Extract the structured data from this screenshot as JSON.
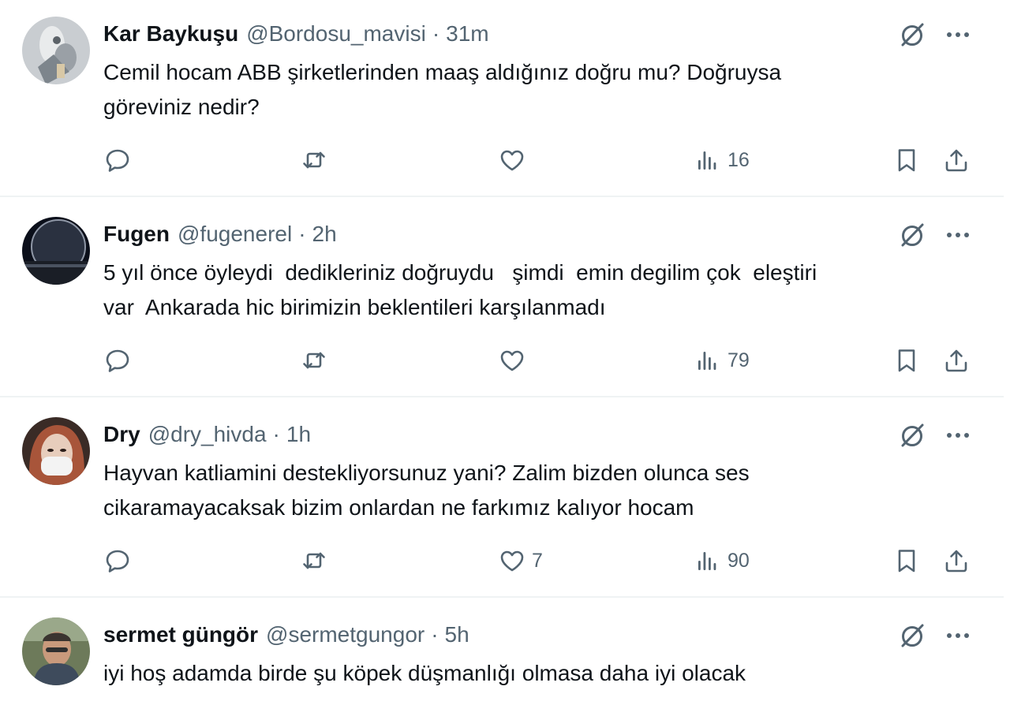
{
  "tweets": [
    {
      "name": "Kar Baykuşu",
      "handle": "@Bordosu_mavisi",
      "separator": "·",
      "time": "31m",
      "text": "Cemil hocam ABB şirketlerinden maaş aldığınız doğru mu? Doğruysa\ngöreviniz nedir?",
      "replies": "",
      "retweets": "",
      "likes": "",
      "views": "16"
    },
    {
      "name": "Fugen",
      "handle": "@fugenerel",
      "separator": "·",
      "time": "2h",
      "text": "5 yıl önce öyleydi  dedikleriniz doğruydu   şimdi  emin degilim çok  eleştiri\nvar  Ankarada hic birimizin beklentileri karşılanmadı",
      "replies": "",
      "retweets": "",
      "likes": "",
      "views": "79"
    },
    {
      "name": "Dry",
      "handle": "@dry_hivda",
      "separator": "·",
      "time": "1h",
      "text": "Hayvan katliamini destekliyorsunuz yani? Zalim bizden olunca ses\ncikaramayacaksak bizim onlardan ne farkımız kalıyor hocam",
      "replies": "",
      "retweets": "",
      "likes": "7",
      "views": "90"
    },
    {
      "name": "sermet güngör",
      "handle": "@sermetgungor",
      "separator": "·",
      "time": "5h",
      "text": "iyi hoş adamda birde şu köpek düşmanlığı olmasa daha iyi olacak"
    }
  ],
  "icons": {
    "grok": "grok-icon",
    "more": "more-icon",
    "reply": "reply-icon",
    "retweet": "retweet-icon",
    "like": "heart-icon",
    "views": "views-icon",
    "bookmark": "bookmark-icon",
    "share": "share-icon"
  },
  "colors": {
    "text_primary": "#0f1419",
    "text_secondary": "#536471",
    "divider": "#eff3f4"
  }
}
